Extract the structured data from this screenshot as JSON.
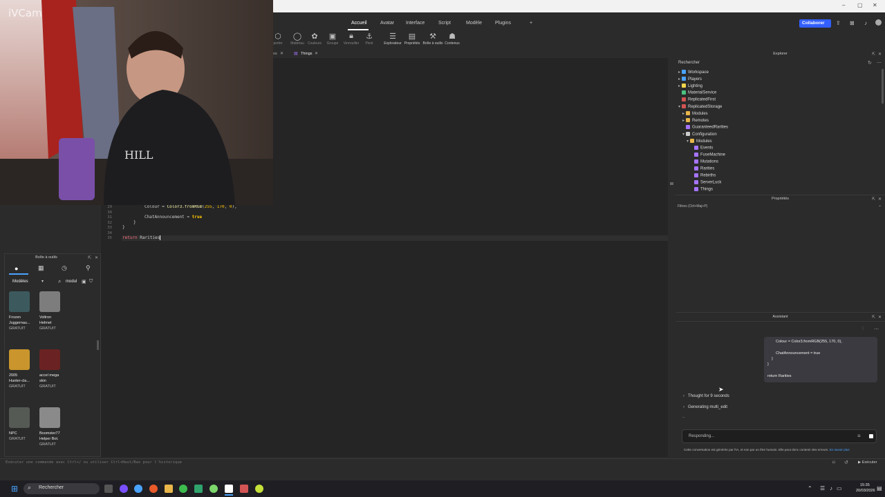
{
  "window": {
    "minimize": "–",
    "maximize": "▢",
    "close": "✕"
  },
  "menu": {
    "tabs": [
      "Accueil",
      "Avatar",
      "Interface",
      "Script",
      "Modèle",
      "Plugins"
    ],
    "add_tab": "+",
    "collaborate": "Collaborer"
  },
  "ribbon": {
    "left_label": "porter",
    "items": [
      "Matériau",
      "Couleurs",
      "Groupe",
      "Verrouiller",
      "Pivot",
      "Explorateur",
      "Propriétés",
      "Boîte à outils",
      "Contenus"
    ]
  },
  "editor_tabs": {
    "first_suffix": "os",
    "active": "Things"
  },
  "code": {
    "line_numbers": [
      "29",
      "30",
      "31",
      "32",
      "33",
      "34",
      "35"
    ],
    "line29_key": "Colour = ",
    "line29_fn": "Color3.fromRGB",
    "line29_args_open": "(",
    "line29_n1": "255",
    "line29_sep1": ", ",
    "line29_n2": "170",
    "line29_sep2": ", ",
    "line29_n3": "0",
    "line29_close": "),",
    "line31_key": "ChatAnnouncement = ",
    "line31_val": "true",
    "line32": "}",
    "line33": "}",
    "line35_kw": "return",
    "line35_rest": " Rarities"
  },
  "webcam": {
    "label": "iVCam"
  },
  "toolbox": {
    "title": "Boîte à outils",
    "category": "Modèles",
    "search_value": "modul",
    "items": [
      {
        "name1": "Frozen",
        "name2": "Juggernau...",
        "price": "GRATUIT",
        "color": "#3c5a5e"
      },
      {
        "name1": "Voltron",
        "name2": "Helmet",
        "price": "GRATUIT",
        "color": "#7d7d7d"
      },
      {
        "name1": "2005",
        "name2": "Hunter-cla...",
        "price": "GRATUIT",
        "color": "#c9952c"
      },
      {
        "name1": "accel mega",
        "name2": "skin",
        "price": "GRATUIT",
        "color": "#6b2222"
      },
      {
        "name1": "NPC",
        "name2": "",
        "price": "GRATUIT",
        "color": "#555a55"
      },
      {
        "name1": "Boomster77",
        "name2": "Helper Bot.",
        "price": "GRATUIT",
        "color": "#8a8a8a"
      }
    ]
  },
  "command_bar": {
    "placeholder": "Exécuter une commande avec Ctrl+/ ou utiliser Ctrl+Haut/Bas pour l'historique",
    "run": "Exécuter"
  },
  "explorer": {
    "title": "Explorer",
    "search": "Rechercher",
    "tree": [
      {
        "label": "Workspace",
        "depth": 0,
        "arrow": "▸",
        "color": "#4aa3ff"
      },
      {
        "label": "Players",
        "depth": 0,
        "arrow": "▸",
        "color": "#4aa3ff"
      },
      {
        "label": "Lighting",
        "depth": 0,
        "arrow": "▸",
        "color": "#f2d64a"
      },
      {
        "label": "MaterialService",
        "depth": 0,
        "arrow": "",
        "color": "#4ac27f"
      },
      {
        "label": "ReplicatedFirst",
        "depth": 0,
        "arrow": "",
        "color": "#d35454"
      },
      {
        "label": "ReplicatedStorage",
        "depth": 0,
        "arrow": "▾",
        "color": "#d35454"
      },
      {
        "label": "Modules",
        "depth": 1,
        "arrow": "▸",
        "color": "#e8b64a"
      },
      {
        "label": "Remotes",
        "depth": 1,
        "arrow": "▸",
        "color": "#e8b64a"
      },
      {
        "label": "GuaranteedRarities",
        "depth": 1,
        "arrow": "",
        "color": "#a774ff"
      },
      {
        "label": "Configuration",
        "depth": 1,
        "arrow": "▾",
        "color": "#cccccc"
      },
      {
        "label": "Modules",
        "depth": 2,
        "arrow": "▾",
        "color": "#e8b64a"
      },
      {
        "label": "Events",
        "depth": 3,
        "arrow": "",
        "color": "#a774ff"
      },
      {
        "label": "FuseMachine",
        "depth": 3,
        "arrow": "",
        "color": "#a774ff"
      },
      {
        "label": "Mutations",
        "depth": 3,
        "arrow": "",
        "color": "#a774ff"
      },
      {
        "label": "Rarities",
        "depth": 3,
        "arrow": "",
        "color": "#a774ff"
      },
      {
        "label": "Rebirths",
        "depth": 3,
        "arrow": "",
        "color": "#a774ff"
      },
      {
        "label": "ServerLuck",
        "depth": 3,
        "arrow": "",
        "color": "#a774ff"
      },
      {
        "label": "Things",
        "depth": 3,
        "arrow": "",
        "color": "#a774ff"
      }
    ]
  },
  "properties": {
    "title": "Propriétés",
    "filter": "Filtres (Ctrl+Maj+P)"
  },
  "assistant": {
    "title": "Assistant",
    "bubble_lines": [
      "Colour = Color3.fromRGB(255, 170, 0),",
      "",
      "ChatAnnouncement = true",
      "}",
      "}",
      "",
      "return Rarities"
    ],
    "thought": "Thought for 9 seconds",
    "generating": "Generating multi_edit",
    "ellipsis": "..",
    "input_placeholder": "Responding...",
    "disclaimer": "Cette conversation est générée par l'IA, et non par un être humain. Elle peut donc contenir des erreurs.",
    "learn_more": "En savoir plus"
  },
  "taskbar": {
    "search": "Rechercher",
    "time": "15:35",
    "date": "20/03/2026"
  }
}
